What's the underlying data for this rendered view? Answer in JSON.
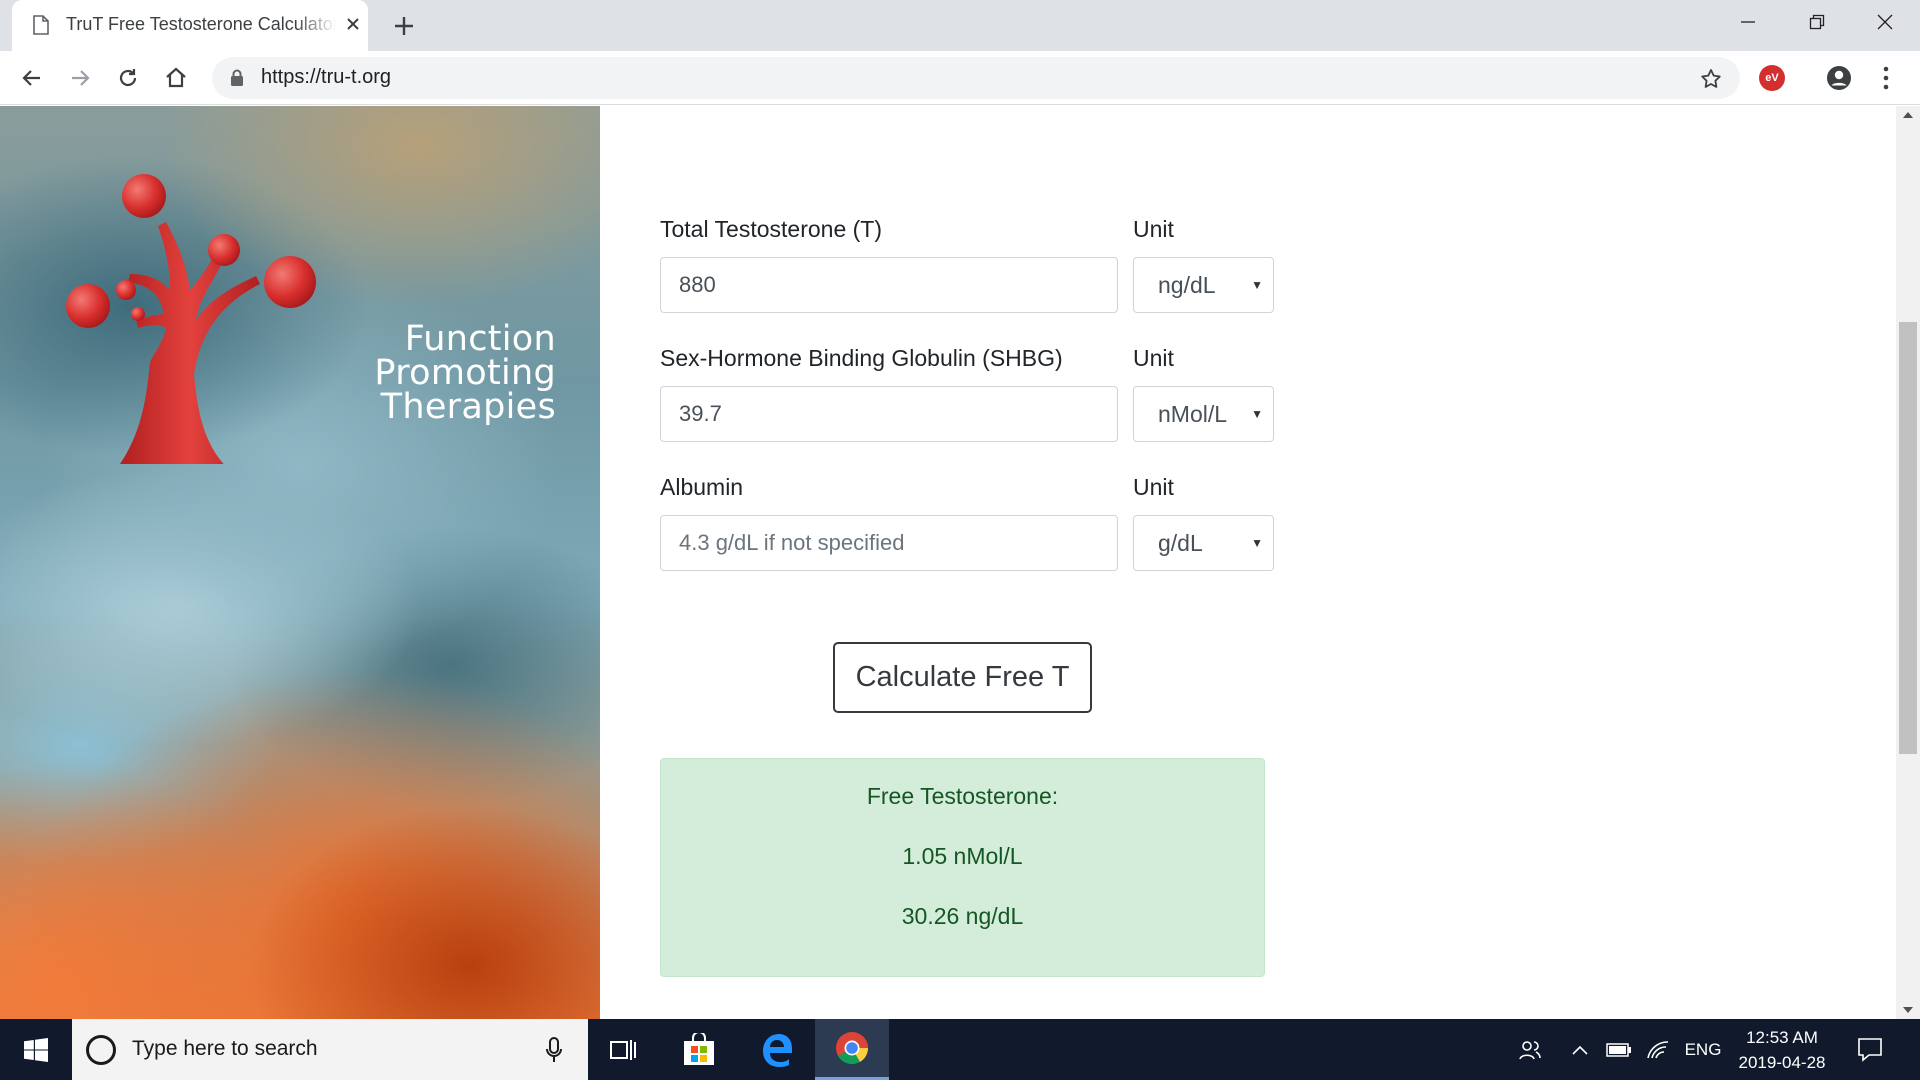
{
  "browser": {
    "tab_title": "TruT Free Testosterone Calculator",
    "url": "https://tru-t.org",
    "extension_badge": "eV"
  },
  "hero": {
    "logo_line1": "Function Promoting",
    "logo_line2": "Therapies"
  },
  "form": {
    "fields": [
      {
        "label": "Total Testosterone (T)",
        "value": "880",
        "placeholder": "",
        "unit_label": "Unit",
        "unit": "ng/dL"
      },
      {
        "label": "Sex-Hormone Binding Globulin (SHBG)",
        "value": "39.7",
        "placeholder": "",
        "unit_label": "Unit",
        "unit": "nMol/L"
      },
      {
        "label": "Albumin",
        "value": "",
        "placeholder": "4.3 g/dL if not specified",
        "unit_label": "Unit",
        "unit": "g/dL"
      }
    ],
    "submit_label": "Calculate Free T"
  },
  "result": {
    "heading": "Free Testosterone:",
    "nmol": "1.05 nMol/L",
    "ngdl": "30.26 ng/dL"
  },
  "taskbar": {
    "search_placeholder": "Type here to search",
    "language": "ENG",
    "time": "12:53 AM",
    "date": "2019-04-28"
  },
  "colors": {
    "result_bg": "#d4edda",
    "result_text": "#155724",
    "logo_red": "#d9302e"
  }
}
